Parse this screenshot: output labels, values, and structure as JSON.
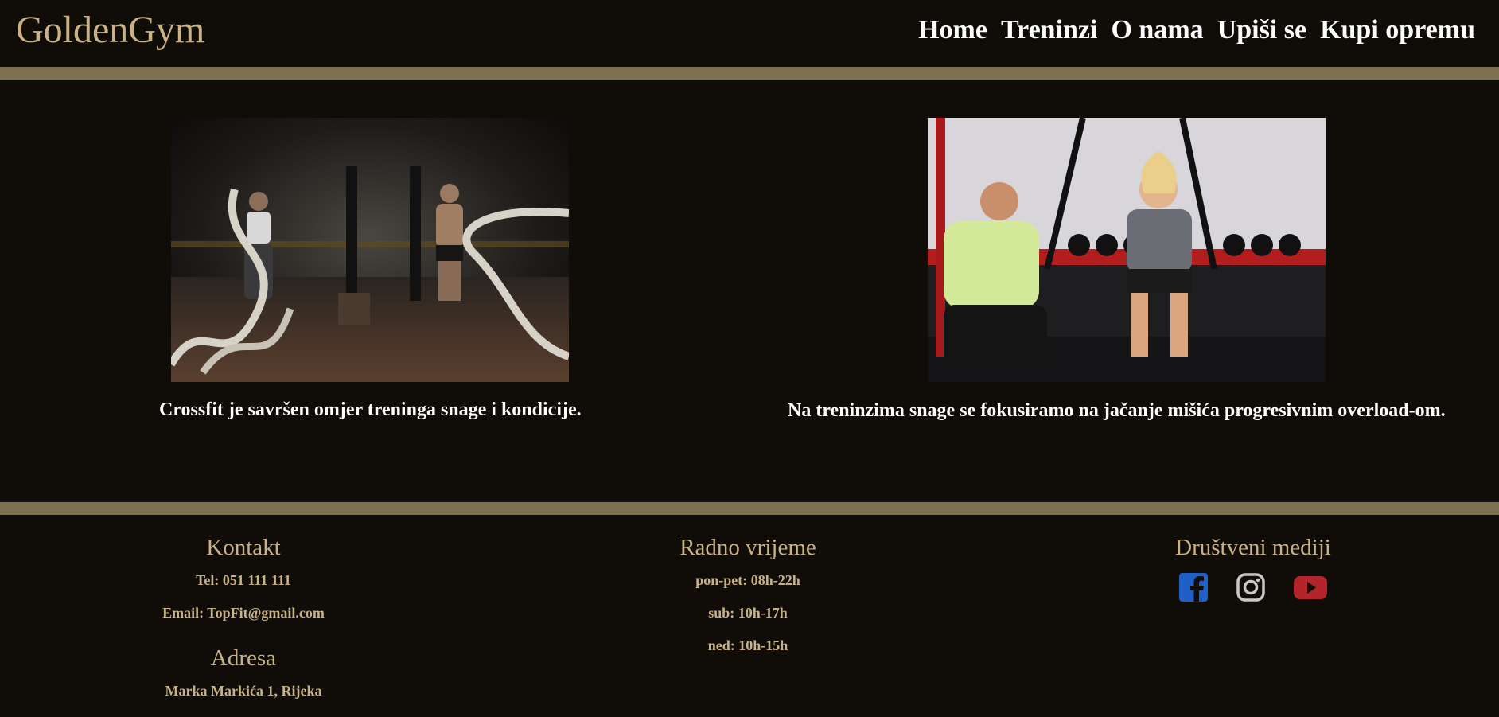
{
  "header": {
    "logo": "GoldenGym",
    "nav": [
      {
        "label": "Home"
      },
      {
        "label": "Treninzi"
      },
      {
        "label": "O nama"
      },
      {
        "label": "Upiši se"
      },
      {
        "label": "Kupi opremu"
      }
    ]
  },
  "main": {
    "cards": [
      {
        "caption": "Crossfit je savršen omjer treninga snage i kondicije.",
        "image": "battle-ropes-photo"
      },
      {
        "caption": "Na treninzima snage se fokusiramo na jačanje mišića progresivnim overload-om.",
        "image": "trx-training-photo"
      }
    ]
  },
  "footer": {
    "contact": {
      "title": "Kontakt",
      "phone": "Tel: 051 111 111",
      "email": "Email: TopFit@gmail.com",
      "address_title": "Adresa",
      "address": "Marka Markića 1, Rijeka"
    },
    "hours": {
      "title": "Radno vrijeme",
      "weekdays": "pon-pet: 08h-22h",
      "saturday": "sub: 10h-17h",
      "sunday": "ned: 10h-15h"
    },
    "social": {
      "title": "Društveni mediji",
      "icons": [
        "facebook-icon",
        "instagram-icon",
        "youtube-icon"
      ]
    }
  },
  "colors": {
    "background": "#100d08",
    "accent_bar": "#7d7152",
    "gold_text": "#c9b386",
    "facebook": "#1877f2",
    "youtube": "#c4302b"
  }
}
